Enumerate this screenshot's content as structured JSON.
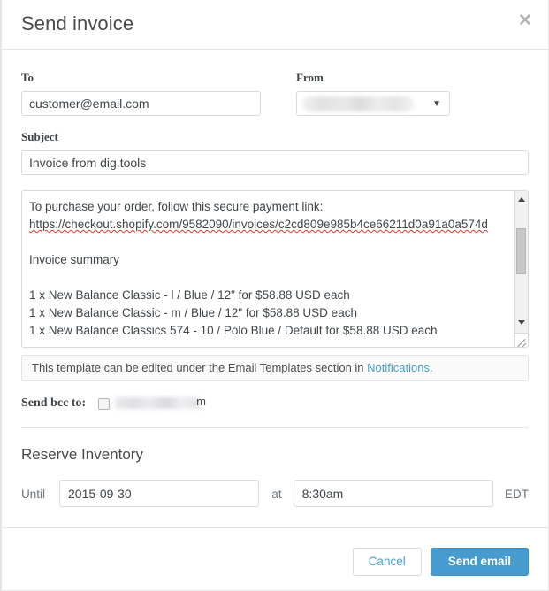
{
  "modal": {
    "title": "Send invoice",
    "close_icon": "close-icon"
  },
  "form": {
    "to": {
      "label": "To",
      "value": "customer@email.com",
      "placeholder": "customer@email.com"
    },
    "from": {
      "label": "From",
      "value": "",
      "redacted": true,
      "caret_icon": "chevron-down-icon"
    },
    "subject": {
      "label": "Subject",
      "value": "Invoice from dig.tools",
      "placeholder": "Invoice from dig.tools"
    },
    "message": {
      "lines": [
        "To purchase your order, follow this secure payment link:",
        "https://checkout.shopify.com/9582090/invoices/c2cd809e985b4ce66211d0a91a0a574d",
        "",
        "Invoice summary",
        "",
        "1 x New Balance Classic - l / Blue / 12\" for $58.88 USD each",
        "1 x New Balance Classic - m / Blue / 12\" for $58.88 USD each",
        "1 x New Balance Classics 574 - 10 / Polo Blue / Default for $58.88 USD each"
      ],
      "scrollbar": {
        "up_icon": "scroll-up-arrow-icon",
        "down_icon": "scroll-down-arrow-icon",
        "resize_icon": "resize-grip-icon"
      }
    },
    "notice": {
      "text_before": "This template can be edited under the Email Templates section in ",
      "link_text": "Notifications",
      "text_after": "."
    },
    "bcc": {
      "label": "Send bcc to:",
      "checked": false,
      "email_redacted": true,
      "email_tail": "m"
    }
  },
  "reserve_inventory": {
    "title": "Reserve Inventory",
    "until_label": "Until",
    "date_value": "2015-09-30",
    "at_label": "at",
    "time_value": "8:30am",
    "timezone": "EDT"
  },
  "footer": {
    "cancel_label": "Cancel",
    "send_label": "Send email"
  },
  "colors": {
    "primary_blue": "#479ccf",
    "link_blue": "#3f9fd4",
    "border_gray": "#d8dbdd",
    "text_dark": "#3f4549",
    "muted": "#6d767c",
    "spellcheck_red": "#e03b2f"
  }
}
